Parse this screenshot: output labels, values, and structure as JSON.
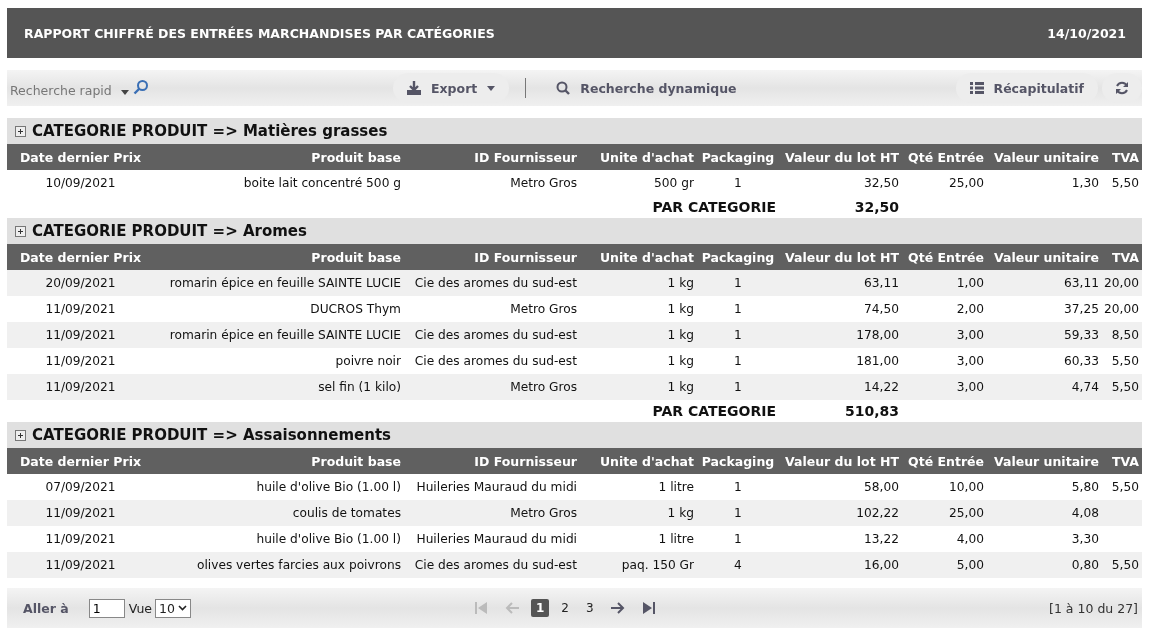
{
  "header": {
    "title": "RAPPORT CHIFFRÉ DES ENTRÉES MARCHANDISES PAR CATÉGORIES",
    "date": "14/10/2021"
  },
  "toolbar": {
    "search": {
      "placeholder": "Recherche rapid"
    },
    "export_button": "Export",
    "dynamic_search_button": "Recherche dynamique",
    "summary_button": "Récapitulatif"
  },
  "categories": [
    {
      "title": "CATEGORIE PRODUIT => Matières grasses",
      "total_label": "PAR CATEGORIE",
      "total": "32,50",
      "columns": [
        "Date dernier Prix",
        "Produit base",
        "ID Fournisseur",
        "Unite d'achat",
        "Packaging",
        "Valeur du lot HT",
        "Qté Entrée",
        "Valeur unitaire",
        "TVA"
      ],
      "rows": [
        {
          "date": "10/09/2021",
          "product": "boite lait concentré 500 g",
          "supplier": "Metro Gros",
          "unit": "500 gr",
          "packaging": "1",
          "lot_value": "32,50",
          "qty": "25,00",
          "unit_value": "1,30",
          "vat": "5,50"
        }
      ]
    },
    {
      "title": "CATEGORIE PRODUIT => Aromes",
      "total_label": "PAR CATEGORIE",
      "total": "510,83",
      "columns": [
        "Date dernier Prix",
        "Produit base",
        "ID Fournisseur",
        "Unite d'achat",
        "Packaging",
        "Valeur du lot HT",
        "Qté Entrée",
        "Valeur unitaire",
        "TVA"
      ],
      "rows": [
        {
          "date": "20/09/2021",
          "product": "romarin épice en feuille SAINTE LUCIE",
          "supplier": "Cie des aromes du sud-est",
          "unit": "1 kg",
          "packaging": "1",
          "lot_value": "63,11",
          "qty": "1,00",
          "unit_value": "63,11",
          "vat": "20,00"
        },
        {
          "date": "11/09/2021",
          "product": "DUCROS Thym",
          "supplier": "Metro Gros",
          "unit": "1 kg",
          "packaging": "1",
          "lot_value": "74,50",
          "qty": "2,00",
          "unit_value": "37,25",
          "vat": "20,00"
        },
        {
          "date": "11/09/2021",
          "product": "romarin épice en feuille SAINTE LUCIE",
          "supplier": "Cie des aromes du sud-est",
          "unit": "1 kg",
          "packaging": "1",
          "lot_value": "178,00",
          "qty": "3,00",
          "unit_value": "59,33",
          "vat": "8,50"
        },
        {
          "date": "11/09/2021",
          "product": "poivre noir",
          "supplier": "Cie des aromes du sud-est",
          "unit": "1 kg",
          "packaging": "1",
          "lot_value": "181,00",
          "qty": "3,00",
          "unit_value": "60,33",
          "vat": "5,50"
        },
        {
          "date": "11/09/2021",
          "product": "sel fin (1 kilo)",
          "supplier": "Metro Gros",
          "unit": "1 kg",
          "packaging": "1",
          "lot_value": "14,22",
          "qty": "3,00",
          "unit_value": "4,74",
          "vat": "5,50"
        }
      ]
    },
    {
      "title": "CATEGORIE PRODUIT => Assaisonnements",
      "columns": [
        "Date dernier Prix",
        "Produit base",
        "ID Fournisseur",
        "Unite d'achat",
        "Packaging",
        "Valeur du lot HT",
        "Qté Entrée",
        "Valeur unitaire",
        "TVA"
      ],
      "rows": [
        {
          "date": "07/09/2021",
          "product": "huile d'olive Bio (1.00 l)",
          "supplier": "Huileries Mauraud du midi",
          "unit": "1 litre",
          "packaging": "1",
          "lot_value": "58,00",
          "qty": "10,00",
          "unit_value": "5,80",
          "vat": "5,50"
        },
        {
          "date": "11/09/2021",
          "product": "coulis de tomates",
          "supplier": "Metro Gros",
          "unit": "1 kg",
          "packaging": "1",
          "lot_value": "102,22",
          "qty": "25,00",
          "unit_value": "4,08"
        },
        {
          "date": "11/09/2021",
          "product": "huile d'olive Bio (1.00 l)",
          "supplier": "Huileries Mauraud du midi",
          "unit": "1 litre",
          "packaging": "1",
          "lot_value": "13,22",
          "qty": "4,00",
          "unit_value": "3,30"
        },
        {
          "date": "11/09/2021",
          "product": "olives vertes farcies aux poivrons",
          "supplier": "Cie des aromes du sud-est",
          "unit": "paq. 150 Gr",
          "packaging": "4",
          "lot_value": "16,00",
          "qty": "5,00",
          "unit_value": "0,80",
          "vat": "5,50"
        }
      ]
    }
  ],
  "pager": {
    "goto_label": "Aller à",
    "goto_value": "1",
    "view_label": "Vue",
    "view_value": "10",
    "nav": [
      {
        "kind": "first",
        "disabled": true
      },
      {
        "kind": "prev",
        "disabled": true
      },
      {
        "kind": "next",
        "disabled": false
      },
      {
        "kind": "last",
        "disabled": false
      }
    ],
    "pages": [
      {
        "label": "1",
        "selected": true
      },
      {
        "label": "2",
        "selected": false
      },
      {
        "label": "3",
        "selected": false
      }
    ],
    "range": "[1 à 10 du 27]"
  }
}
